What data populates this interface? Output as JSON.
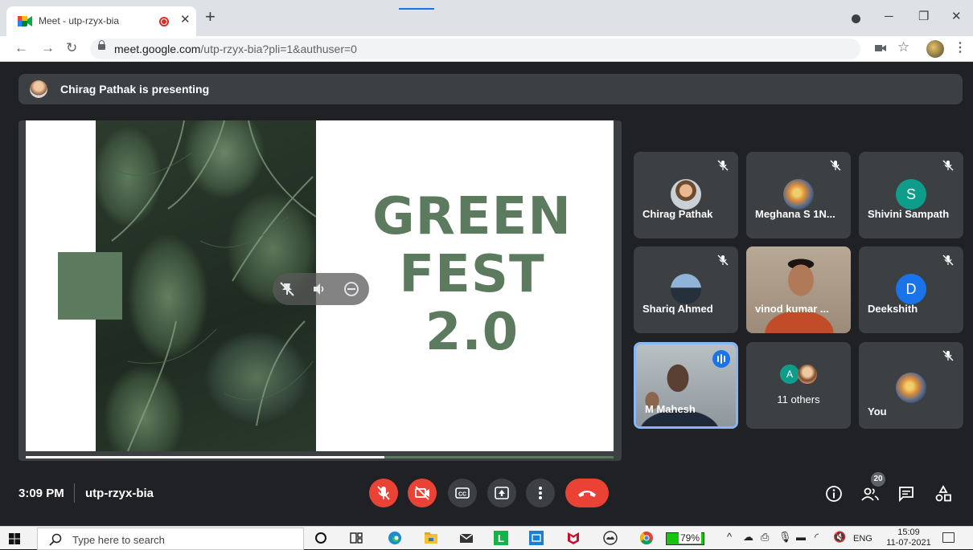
{
  "browser": {
    "tab_title": "Meet - utp-rzyx-bia",
    "url_host": "meet.google.com",
    "url_path": "/utp-rzyx-bia?pli=1&authuser=0"
  },
  "meet": {
    "presenting_banner": "Chirag Pathak is presenting",
    "slide": {
      "line1": "GREEN",
      "line2": "FEST",
      "line3": "2.0",
      "progress": 0.61
    },
    "participants": [
      {
        "name": "Chirag Pathak",
        "avatar": "photo",
        "muted": true
      },
      {
        "name": "Meghana S 1N...",
        "avatar": "photo",
        "muted": true
      },
      {
        "name": "Shivini Sampath",
        "avatar_letter": "S",
        "avatar_color": "#0f9d8b",
        "muted": true
      },
      {
        "name": "Shariq Ahmed",
        "avatar": "photo",
        "muted": true
      },
      {
        "name": "vinod kumar ...",
        "avatar": "camera",
        "muted": false
      },
      {
        "name": "Deekshith",
        "avatar_letter": "D",
        "avatar_color": "#1a73e8",
        "muted": true
      },
      {
        "name": "M Mahesh",
        "avatar": "camera",
        "speaking": true
      },
      {
        "name": "11 others",
        "avatar_letter": "A",
        "avatar_color": "#0f9d8b"
      },
      {
        "name": "You",
        "avatar": "photo",
        "muted": true
      }
    ],
    "bottom": {
      "time": "3:09 PM",
      "meeting_code": "utp-rzyx-bia",
      "people_count": "20"
    },
    "colors": {
      "slide_green": "#5c7a5d",
      "end_call": "#ea4335",
      "speaking": "#1a73e8"
    }
  },
  "taskbar": {
    "search_placeholder": "Type here to search",
    "battery": "79%",
    "lang": "ENG",
    "time": "15:09",
    "date": "11-07-2021"
  }
}
